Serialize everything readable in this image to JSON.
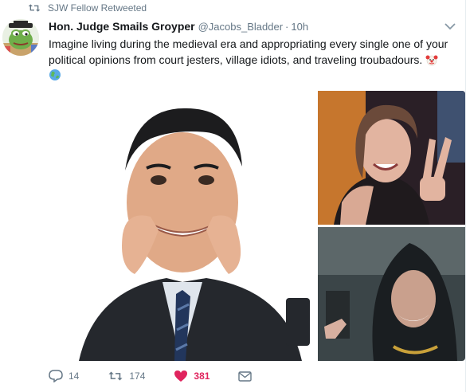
{
  "retweet_context": {
    "label": "SJW Fellow Retweeted",
    "icon": "retweet-icon"
  },
  "author": {
    "fullname": "Hon. Judge Smails Groyper",
    "username": "@Jacobs_Bladder",
    "separator": "·",
    "time": "10h",
    "avatar": "frog-avatar"
  },
  "tweet": {
    "text": "Imagine living during the medieval era and appropriating every single one of your political opinions from court jesters, village idiots, and traveling troubadours.",
    "emojis": [
      "clown-face-emoji",
      "globe-emoji"
    ]
  },
  "media": {
    "photos": [
      "man-in-suit-stretching-smile",
      "woman-making-peace-sign",
      "man-in-hood-speaking"
    ]
  },
  "actions": {
    "reply": {
      "icon": "reply-icon",
      "count": "14"
    },
    "retweet": {
      "icon": "retweet-icon",
      "count": "174"
    },
    "like": {
      "icon": "heart-icon",
      "count": "381",
      "color": "#e0245e"
    },
    "message": {
      "icon": "envelope-icon"
    }
  },
  "colors": {
    "secondary_text": "#657786",
    "like": "#e0245e",
    "text": "#14171a"
  }
}
